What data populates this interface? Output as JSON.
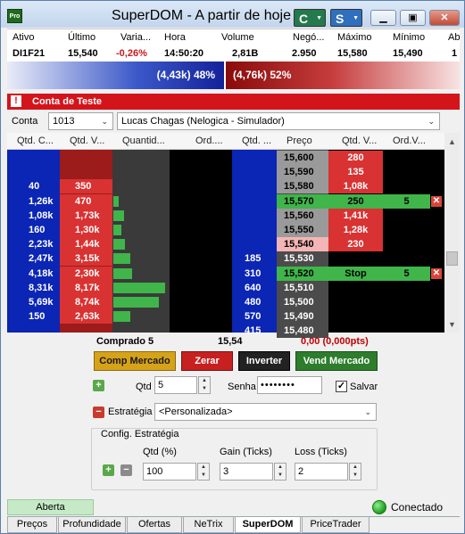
{
  "window": {
    "title": "SuperDOM - A partir de hoje",
    "btn_c": "C",
    "btn_s": "S",
    "app_icon": "Pro",
    "minimize_icon": "minimize-icon",
    "maximize_icon": "maximize-icon",
    "close_icon": "close-icon"
  },
  "quote": {
    "headers": [
      "Ativo",
      "Último",
      "Varia...",
      "Hora",
      "Volume",
      "Negó...",
      "Máximo",
      "Mínimo",
      "Ab"
    ],
    "values": [
      "DI1F21",
      "15,540",
      "-0,26%",
      "14:50:20",
      "2,81B",
      "2.950",
      "15,580",
      "15,490",
      "1"
    ]
  },
  "pressure": {
    "buy_label": "(4,43k) 48%",
    "sell_label": "(4,76k) 52%",
    "buy_pct": 48,
    "sell_pct": 52
  },
  "account_bar": {
    "warning_icon": "!",
    "label": "Conta de Teste"
  },
  "account": {
    "label": "Conta",
    "number": "1013",
    "name": "Lucas Chagas (Nelogica - Simulador)"
  },
  "grid": {
    "headers": [
      "Qtd. C...",
      "Qtd. V...",
      "Quantid...",
      "Ord....",
      "Qtd. ...",
      "Preço",
      "Qtd. V...",
      "Ord.V..."
    ],
    "rows": [
      {
        "qc": "",
        "qv": "",
        "quant": "",
        "ord": "",
        "qtd": "",
        "price": "15,600",
        "sell": "280",
        "ordv": "",
        "bar": 0
      },
      {
        "qc": "",
        "qv": "",
        "quant": "",
        "ord": "",
        "qtd": "",
        "price": "15,590",
        "sell": "135",
        "ordv": "",
        "bar": 0
      },
      {
        "qc": "40",
        "qv": "350",
        "quant": "",
        "ord": "",
        "qtd": "",
        "price": "15,580",
        "sell": "1,08k",
        "ordv": "",
        "bar": 0
      },
      {
        "qc": "1,26k",
        "qv": "470",
        "quant": "",
        "ord": "",
        "qtd": "",
        "price": "15,570",
        "sell": "250",
        "ordv": "5",
        "bar": 0.1
      },
      {
        "qc": "1,08k",
        "qv": "1,73k",
        "quant": "",
        "ord": "",
        "qtd": "",
        "price": "15,560",
        "sell": "1,41k",
        "ordv": "",
        "bar": 0.2
      },
      {
        "qc": "160",
        "qv": "1,30k",
        "quant": "",
        "ord": "",
        "qtd": "",
        "price": "15,550",
        "sell": "1,28k",
        "ordv": "",
        "bar": 0.15
      },
      {
        "qc": "2,23k",
        "qv": "1,44k",
        "quant": "",
        "ord": "",
        "qtd": "",
        "price": "15,540",
        "sell": "230",
        "ordv": "",
        "bar": 0.22
      },
      {
        "qc": "2,47k",
        "qv": "3,15k",
        "quant": "",
        "ord": "",
        "qtd": "185",
        "price": "15,530",
        "sell": "",
        "ordv": "",
        "bar": 0.33
      },
      {
        "qc": "4,18k",
        "qv": "2,30k",
        "quant": "",
        "ord": "",
        "qtd": "310",
        "price": "15,520",
        "sell": "Stop",
        "ordv": "5",
        "bar": 0.37
      },
      {
        "qc": "8,31k",
        "qv": "8,17k",
        "quant": "",
        "ord": "",
        "qtd": "640",
        "price": "15,510",
        "sell": "",
        "ordv": "",
        "bar": 1.0
      },
      {
        "qc": "5,69k",
        "qv": "8,74k",
        "quant": "",
        "ord": "",
        "qtd": "480",
        "price": "15,500",
        "sell": "",
        "ordv": "",
        "bar": 0.88
      },
      {
        "qc": "150",
        "qv": "2,63k",
        "quant": "",
        "ord": "",
        "qtd": "570",
        "price": "15,490",
        "sell": "",
        "ordv": "",
        "bar": 0.33
      },
      {
        "qc": "",
        "qv": "",
        "quant": "",
        "ord": "",
        "qtd": "415",
        "price": "15,480",
        "sell": "",
        "ordv": "",
        "bar": 0
      }
    ]
  },
  "position": {
    "status": "Comprado 5",
    "avg_price": "15,54",
    "pnl": "0,00 (0,000pts)"
  },
  "actions": {
    "buy_market": "Comp Mercado",
    "zero": "Zerar",
    "invert": "Inverter",
    "sell_market": "Vend Mercado"
  },
  "order": {
    "qty_label": "Qtd",
    "qty_value": "5",
    "password_label": "Senha",
    "password_value": "••••••••",
    "save_label": "Salvar",
    "save_checked": true,
    "strategy_label": "Estratégia",
    "strategy_value": "<Personalizada>"
  },
  "strategy_config": {
    "title": "Config. Estratégia",
    "qty_pct_label": "Qtd (%)",
    "qty_pct_value": "100",
    "gain_label": "Gain (Ticks)",
    "gain_value": "3",
    "loss_label": "Loss (Ticks)",
    "loss_value": "2"
  },
  "status": {
    "market": "Aberta",
    "connection": "Conectado"
  },
  "tabs": [
    "Preços",
    "Profundidade",
    "Ofertas",
    "NeTrix",
    "SuperDOM",
    "PriceTrader"
  ],
  "active_tab": "SuperDOM",
  "colors": {
    "buy_blue": "#0b25b4",
    "sell_red": "#dd2b2b",
    "price_grey": "#4b4b4b",
    "order_green": "#3fb54a"
  }
}
